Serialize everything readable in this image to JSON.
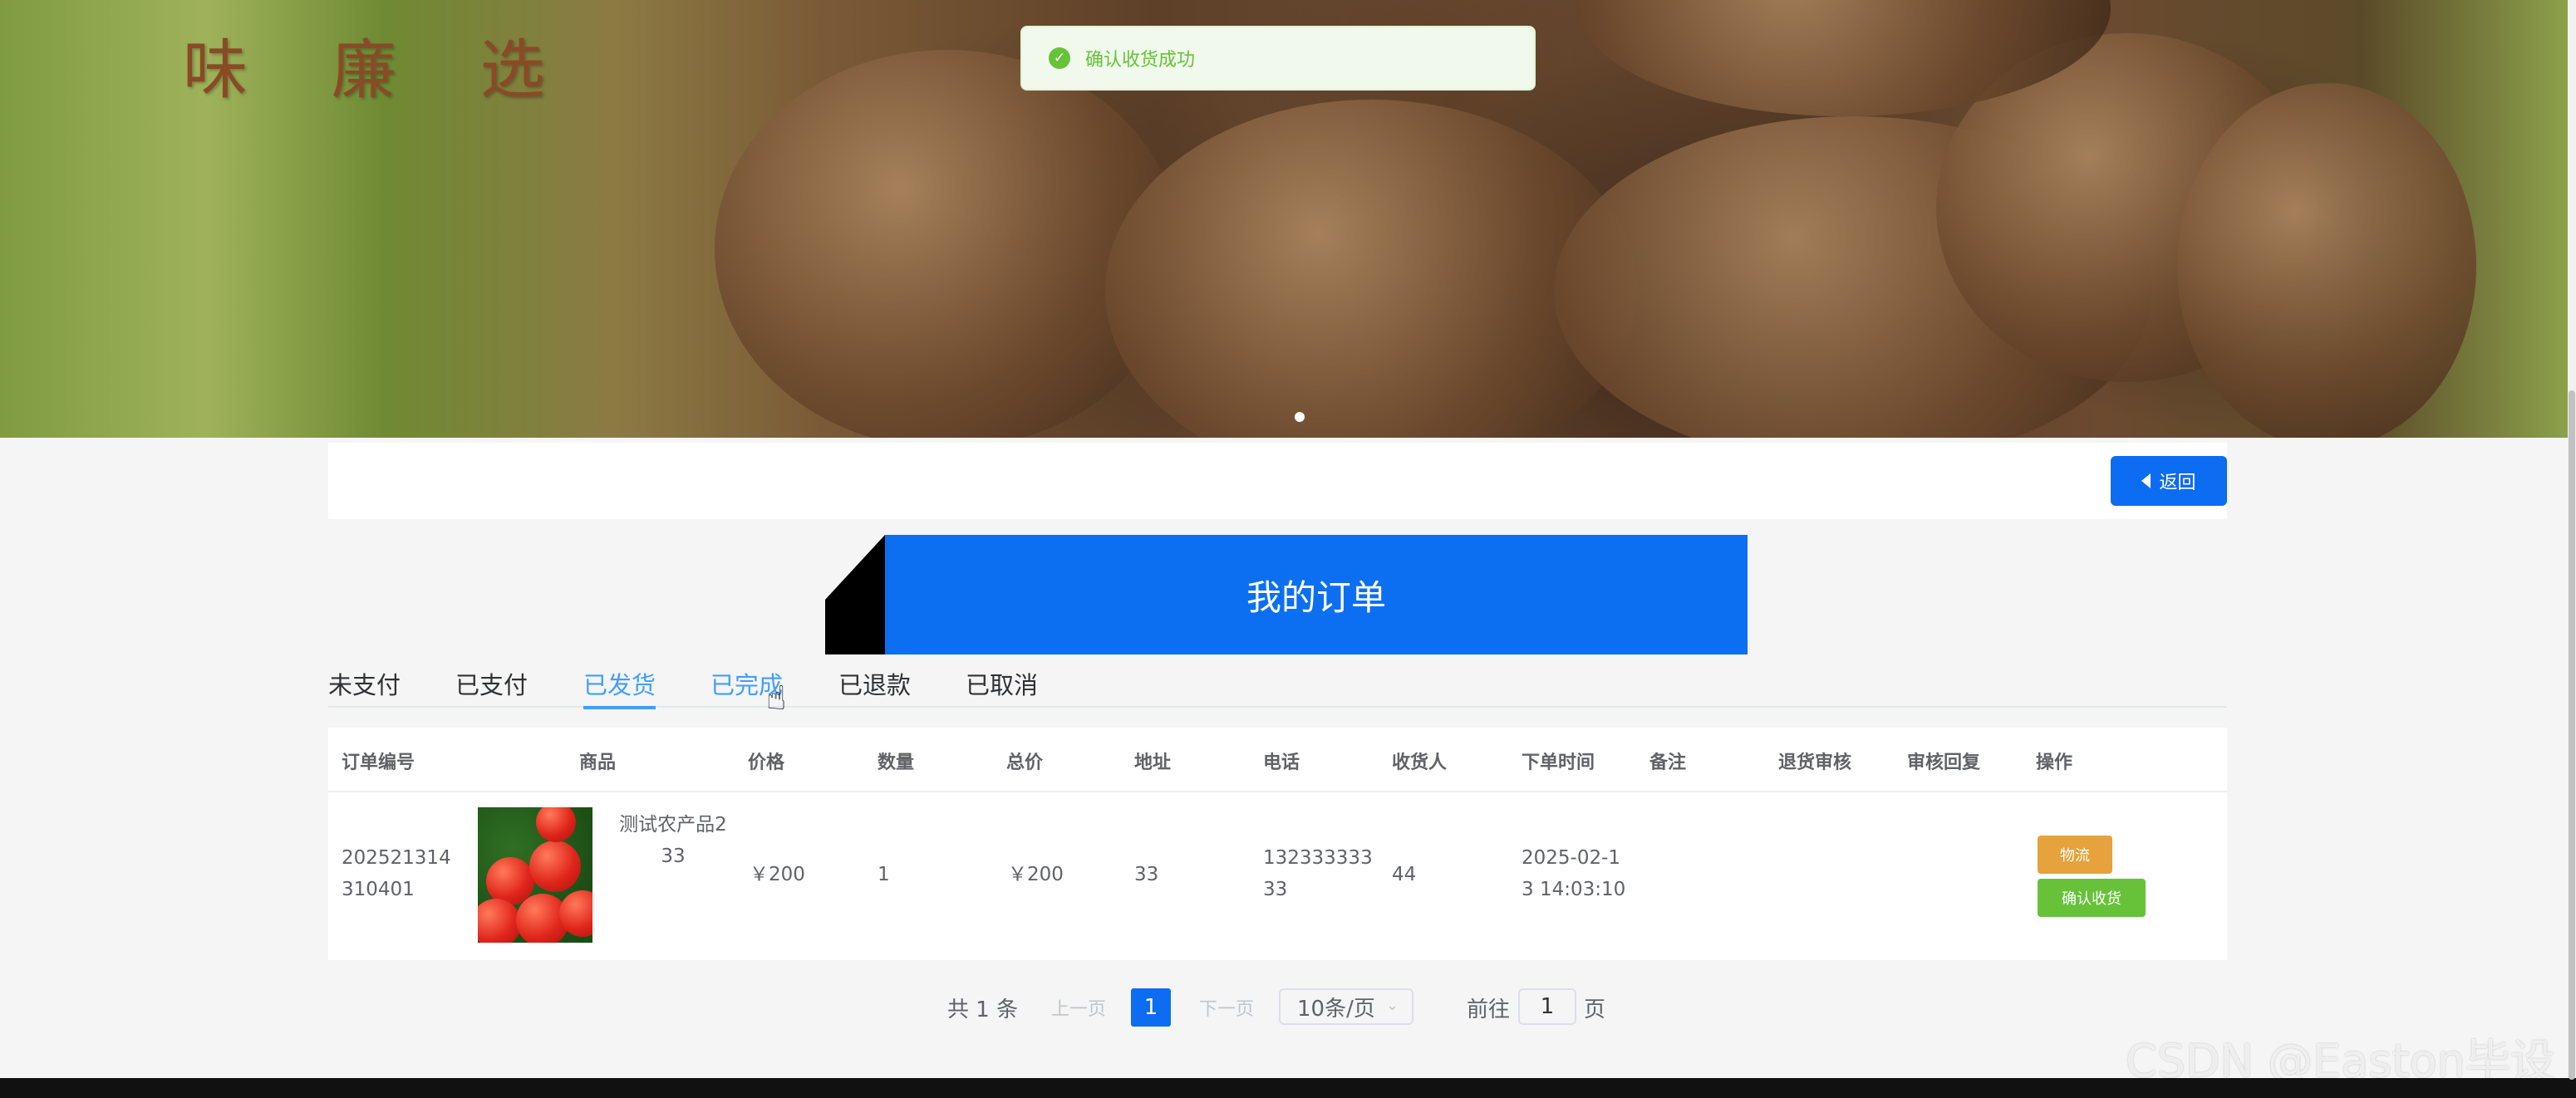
{
  "brand": {
    "logo_text": "味 廉 选"
  },
  "toast": {
    "message": "确认收货成功",
    "type": "success"
  },
  "back_button": {
    "label": "返回"
  },
  "page_title": "我的订单",
  "tabs": [
    {
      "label": "未支付",
      "state": "normal"
    },
    {
      "label": "已支付",
      "state": "normal"
    },
    {
      "label": "已发货",
      "state": "active"
    },
    {
      "label": "已完成",
      "state": "hover"
    },
    {
      "label": "已退款",
      "state": "normal"
    },
    {
      "label": "已取消",
      "state": "normal"
    }
  ],
  "table": {
    "headers": [
      "订单编号",
      "商品",
      "价格",
      "数量",
      "总价",
      "地址",
      "电话",
      "收货人",
      "下单时间",
      "备注",
      "退货审核",
      "审核回复",
      "操作"
    ],
    "rows": [
      {
        "order_no_line1": "202521314",
        "order_no_line2": "310401",
        "product_name_line1": "测试农产品2",
        "product_name_line2": "33",
        "price": "￥200",
        "quantity": "1",
        "total": "￥200",
        "address": "33",
        "phone_line1": "132333333",
        "phone_line2": "33",
        "receiver": "44",
        "order_time_line1": "2025-02-1",
        "order_time_line2": "3 14:03:10",
        "remark": "",
        "return_review": "",
        "review_reply": "",
        "actions": {
          "logistics": "物流",
          "confirm": "确认收货"
        }
      }
    ]
  },
  "pagination": {
    "total": "共 1 条",
    "prev": "上一页",
    "current_page": "1",
    "next": "下一页",
    "page_size": "10条/页",
    "goto_label": "前往",
    "goto_value": "1",
    "goto_unit": "页"
  },
  "watermark": "CSDN @Easton毕设",
  "colors": {
    "primary": "#0c6cf2",
    "success": "#67c23a",
    "warning": "#e6a23c",
    "tab_active": "#409eff"
  },
  "icons": {
    "toast": "check-circle-icon",
    "back": "caret-left-icon",
    "page_size": "chevron-down-icon",
    "cursor": "pointer-hand-icon"
  }
}
